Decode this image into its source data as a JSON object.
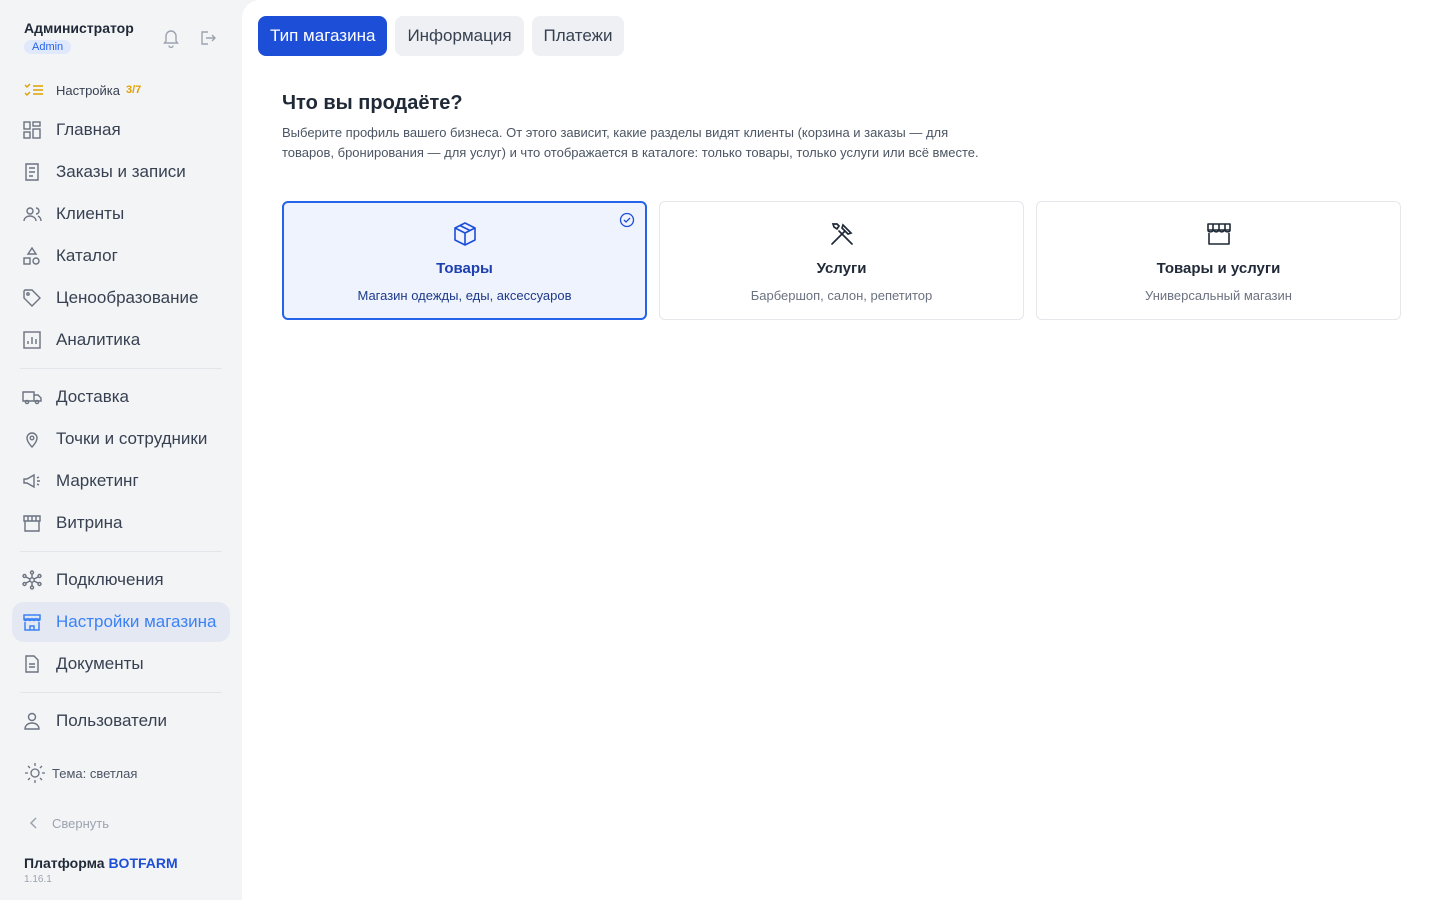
{
  "user": {
    "name": "Администратор",
    "role": "Admin"
  },
  "setup": {
    "label": "Настройка",
    "count": "3/7"
  },
  "nav_group1": [
    {
      "label": "Главная",
      "icon": "dashboard-icon"
    },
    {
      "label": "Заказы и записи",
      "icon": "receipt-icon"
    },
    {
      "label": "Клиенты",
      "icon": "users-icon"
    },
    {
      "label": "Каталог",
      "icon": "shapes-icon"
    },
    {
      "label": "Ценообразование",
      "icon": "tag-icon"
    },
    {
      "label": "Аналитика",
      "icon": "chart-icon"
    }
  ],
  "nav_group2": [
    {
      "label": "Доставка",
      "icon": "truck-icon"
    },
    {
      "label": "Точки и сотрудники",
      "icon": "map-pin-icon"
    },
    {
      "label": "Маркетинг",
      "icon": "megaphone-icon"
    },
    {
      "label": "Витрина",
      "icon": "storefront-icon"
    }
  ],
  "nav_group3": [
    {
      "label": "Подключения",
      "icon": "network-icon"
    },
    {
      "label": "Настройки магазина",
      "icon": "store-icon",
      "active": true
    },
    {
      "label": "Документы",
      "icon": "document-icon"
    }
  ],
  "nav_group4": [
    {
      "label": "Пользователи",
      "icon": "user-icon"
    }
  ],
  "theme": {
    "label": "Тема: светлая"
  },
  "collapse": {
    "label": "Свернуть"
  },
  "brand": {
    "prefix": "Платформа",
    "name": "BOTFARM",
    "version": "1.16.1"
  },
  "tabs": [
    {
      "label": "Тип магазина",
      "active": true
    },
    {
      "label": "Информация",
      "active": false
    },
    {
      "label": "Платежи",
      "active": false
    }
  ],
  "section": {
    "title": "Что вы продаёте?",
    "description": "Выберите профиль вашего бизнеса. От этого зависит, какие разделы видят клиенты (корзина и заказы — для товаров, бронирования — для услуг) и что отображается в каталоге: только товары, только услуги или всё вместе."
  },
  "cards": [
    {
      "title": "Товары",
      "subtitle": "Магазин одежды, еды, аксессуаров",
      "icon": "box-icon",
      "selected": true
    },
    {
      "title": "Услуги",
      "subtitle": "Барбершоп, салон, репетитор",
      "icon": "tools-icon",
      "selected": false
    },
    {
      "title": "Товары и услуги",
      "subtitle": "Универсальный магазин",
      "icon": "storefront-icon",
      "selected": false
    }
  ],
  "colors": {
    "accent": "#1d4ed8",
    "active_nav_bg": "#e3e8f3",
    "setup_badge": "#e0a100"
  }
}
